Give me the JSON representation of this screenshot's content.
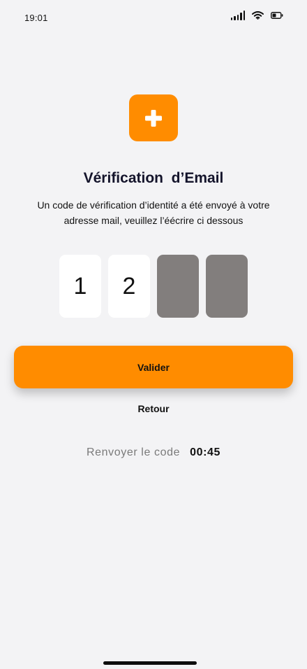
{
  "status_bar": {
    "time": "19:01",
    "icons": [
      "signal-icon",
      "wifi-icon",
      "battery-icon"
    ]
  },
  "logo": {
    "icon": "plus-icon",
    "color": "#ff8c00"
  },
  "title": "Vérification  d’Email",
  "subtitle": "Un  code de vérification d’identité  a été envoyé à votre\nadresse mail, veuillez l’éécrire ci dessous",
  "code": {
    "digits": [
      "1",
      "2",
      "",
      ""
    ],
    "filled_color": "#ffffff",
    "empty_color": "#827e7d"
  },
  "buttons": {
    "validate_label": "Valider",
    "back_label": "Retour"
  },
  "resend": {
    "label": "Renvoyer le code",
    "timer": "00:45"
  },
  "colors": {
    "accent": "#ff8c00",
    "background": "#f3f3f5"
  }
}
